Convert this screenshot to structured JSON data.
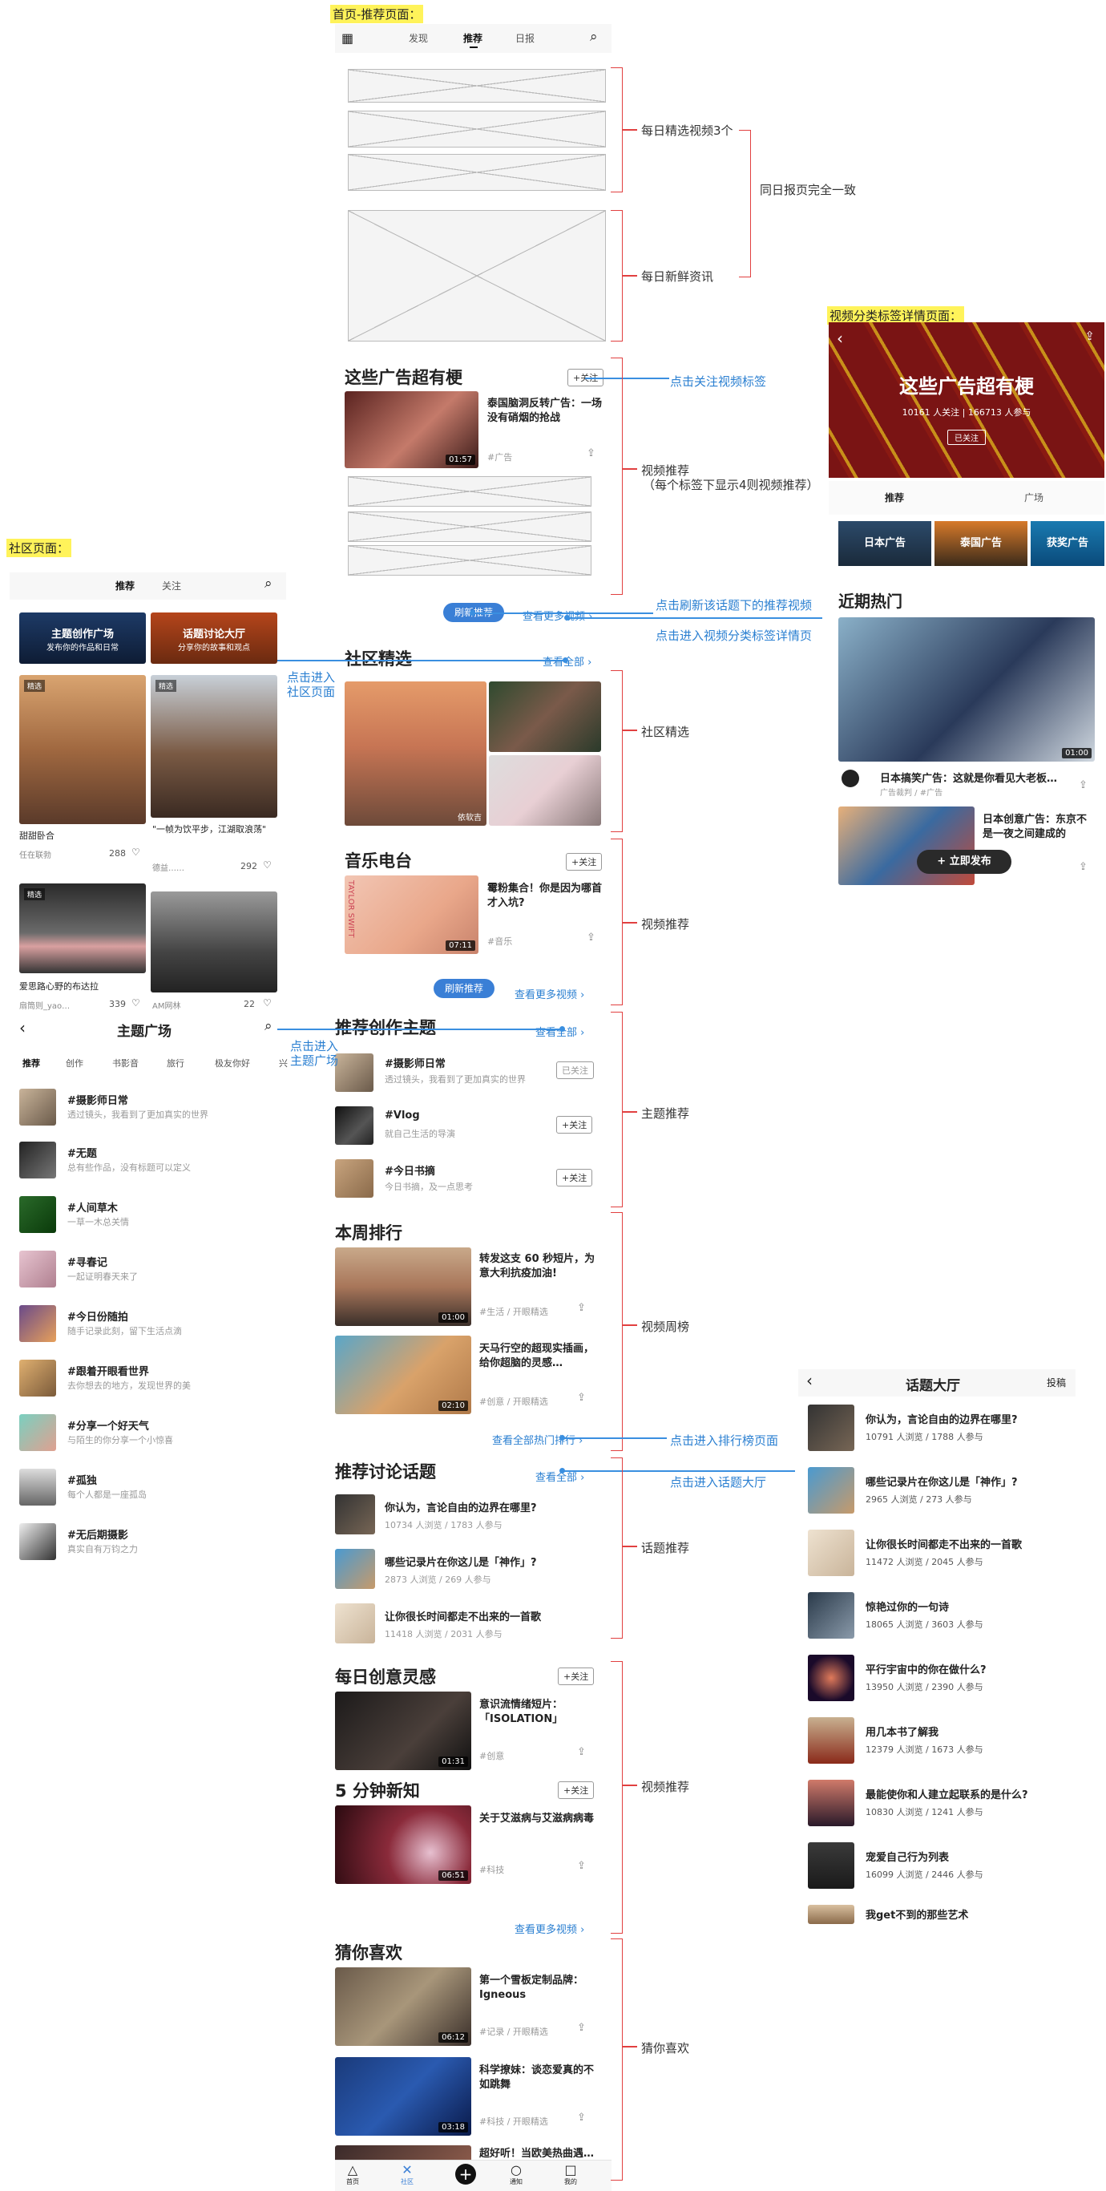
{
  "labels": {
    "home": "首页-推荐页面：",
    "community": "社区页面：",
    "category": "视频分类标签详情页面："
  },
  "home": {
    "tabs": [
      "发现",
      "推荐",
      "日报"
    ],
    "ad_section": {
      "title": "这些广告超有梗",
      "follow": "+关注",
      "video_title": "泰国脑洞反转广告：一场没有硝烟的抢战",
      "tag": "#广告",
      "duration": "01:57"
    },
    "refresh": "刷新推荐",
    "see_more_videos": "查看更多视频 ›",
    "community": {
      "title": "社区精选",
      "see_all": "查看全部 ›",
      "author": "依软吉"
    },
    "music": {
      "title": "音乐电台",
      "follow": "+关注",
      "video_title": "霉粉集合！你是因为哪首才入坑?",
      "tag": "#音乐",
      "duration": "07:11",
      "cover_text": "TAYLOR SWIFT"
    },
    "refresh2": "刷新推荐",
    "see_more2": "查看更多视频 ›",
    "topics": {
      "title": "推荐创作主题",
      "see_all": "查看全部 ›",
      "items": [
        {
          "name": "#摄影师日常",
          "desc": "透过镜头，我看到了更加真实的世界",
          "btn": "已关注"
        },
        {
          "name": "#Vlog",
          "desc": "就自己生活的导演",
          "btn": "+关注"
        },
        {
          "name": "#今日书摘",
          "desc": "今日书摘，及一点思考",
          "btn": "+关注"
        }
      ]
    },
    "weekly": {
      "title": "本周排行",
      "items": [
        {
          "title": "转发这支 60 秒短片，为意大利抗疫加油!",
          "tag": "#生活 / 开眼精选",
          "duration": "01:00"
        },
        {
          "title": "天马行空的超现实插画，给你超脑的灵感…",
          "tag": "#创意 / 开眼精选",
          "duration": "02:10"
        }
      ],
      "see_all": "查看全部热门排行 ›"
    },
    "discuss": {
      "title": "推荐讨论话题",
      "see_all": "查看全部 ›",
      "items": [
        {
          "title": "你认为，言论自由的边界在哪里?",
          "stat": "10734 人浏览 / 1783 人参与"
        },
        {
          "title": "哪些记录片在你这儿是「神作」?",
          "stat": "2873 人浏览 / 269 人参与"
        },
        {
          "title": "让你很长时间都走不出来的一首歌",
          "stat": "11418 人浏览 / 2031 人参与"
        }
      ]
    },
    "creative": {
      "title": "每日创意灵感",
      "follow": "+关注",
      "video_title": "意识流情绪短片：「ISOLATION」",
      "tag": "#创意",
      "duration": "01:31"
    },
    "five": {
      "title": "5 分钟新知",
      "follow": "+关注",
      "video_title": "关于艾滋病与艾滋病病毒",
      "tag": "#科技",
      "duration": "06:51"
    },
    "see_more3": "查看更多视频 ›",
    "guess": {
      "title": "猜你喜欢",
      "items": [
        {
          "title": "第一个雪板定制品牌：Igneous",
          "tag": "#记录 / 开眼精选",
          "duration": "06:12"
        },
        {
          "title": "科学撩妹：谈恋爱真的不如跳舞",
          "tag": "#科技 / 开眼精选",
          "duration": "03:18"
        },
        {
          "title": "超好听！当欧美热曲遇…",
          "tag": "",
          "duration": ""
        }
      ]
    },
    "bottom_nav": [
      "首页",
      "社区",
      "",
      "通知",
      "我的"
    ]
  },
  "annotations": {
    "daily3": "每日精选视频3个",
    "same_daily": "同日报页完全一致",
    "daily_news": "每日新鲜资讯",
    "follow_tag": "点击关注视频标签",
    "video_rec": "视频推荐",
    "video_rec_sub": "（每个标签下显示4则视频推荐）",
    "refresh_note": "点击刷新该话题下的推荐视频",
    "enter_category": "点击进入视频分类标签详情页",
    "enter_community": "点击进入\n社区页面",
    "community_pick": "社区精选",
    "video_rec2": "视频推荐",
    "enter_topic": "点击进入\n主题广场",
    "topic_rec": "主题推荐",
    "weekly": "视频周榜",
    "enter_rank": "点击进入排行榜页面",
    "enter_hall": "点击进入话题大厅",
    "discuss_rec": "话题推荐",
    "video_rec3": "视频推荐",
    "guess": "猜你喜欢"
  },
  "community_page": {
    "tabs": [
      "推荐",
      "关注"
    ],
    "banner_left": {
      "title": "主题创作广场",
      "sub": "发布你的作品和日常"
    },
    "banner_right": {
      "title": "话题讨论大厅",
      "sub": "分享你的故事和观点"
    },
    "cards": [
      {
        "caption": "甜甜卧合",
        "user": "任在联勃",
        "likes": "288",
        "badge": "精选"
      },
      {
        "caption": "\"一帧为饮平步，江湖取浪荡\"",
        "user": "德益……",
        "likes": "292",
        "badge": "精选"
      },
      {
        "caption": "爱思路心野的布达拉",
        "user": "扇筒则_yao…",
        "likes": "339",
        "badge": "精选"
      },
      {
        "caption": "",
        "user": "AM网林",
        "likes": "22",
        "badge": ""
      }
    ]
  },
  "topic_square": {
    "title": "主题广场",
    "tabs": [
      "推荐",
      "创作",
      "书影音",
      "旅行",
      "极友你好",
      "兴"
    ],
    "items": [
      {
        "name": "#摄影师日常",
        "desc": "透过镜头，我看到了更加真实的世界"
      },
      {
        "name": "#无题",
        "desc": "总有些作品，没有标题可以定义"
      },
      {
        "name": "#人间草木",
        "desc": "一草一木总关情"
      },
      {
        "name": "#寻春记",
        "desc": "一起证明春天来了"
      },
      {
        "name": "#今日份随拍",
        "desc": "随手记录此刻，留下生活点滴"
      },
      {
        "name": "#跟着开眼看世界",
        "desc": "去你想去的地方，发现世界的美"
      },
      {
        "name": "#分享一个好天气",
        "desc": "与陌生的你分享一个小惊喜"
      },
      {
        "name": "#孤独",
        "desc": "每个人都是一座孤岛"
      },
      {
        "name": "#无后期摄影",
        "desc": "真实自有万钧之力"
      }
    ]
  },
  "category_page": {
    "title": "这些广告超有梗",
    "stats": "10161 人关注 | 166713 人参与",
    "followed": "已关注",
    "tabs": [
      "推荐",
      "广场"
    ],
    "chips": [
      "日本广告",
      "泰国广告",
      "获奖广告"
    ],
    "recent": "近期热门",
    "items": [
      {
        "title": "日本搞笑广告：这就是你看见大老板…",
        "tag": "广告裁判 / #广告",
        "duration": "01:00"
      },
      {
        "title": "日本创意广告：东京不是一夜之间建成的",
        "tag": "",
        "duration": ""
      }
    ],
    "publish": "+ 立即发布"
  },
  "hall": {
    "title": "话题大厅",
    "action": "投稿",
    "items": [
      {
        "title": "你认为，言论自由的边界在哪里?",
        "stat": "10791 人浏览 / 1788 人参与"
      },
      {
        "title": "哪些记录片在你这儿是「神作」?",
        "stat": "2965 人浏览 / 273 人参与"
      },
      {
        "title": "让你很长时间都走不出来的一首歌",
        "stat": "11472 人浏览 / 2045 人参与"
      },
      {
        "title": "惊艳过你的一句诗",
        "stat": "18065 人浏览 / 3603 人参与"
      },
      {
        "title": "平行宇宙中的你在做什么?",
        "stat": "13950 人浏览 / 2390 人参与"
      },
      {
        "title": "用几本书了解我",
        "stat": "12379 人浏览 / 1673 人参与"
      },
      {
        "title": "最能使你和人建立起联系的是什么?",
        "stat": "10830 人浏览 / 1241 人参与"
      },
      {
        "title": "宠爱自己行为列表",
        "stat": "16099 人浏览 / 2446 人参与"
      },
      {
        "title": "我get不到的那些艺术",
        "stat": ""
      }
    ]
  }
}
